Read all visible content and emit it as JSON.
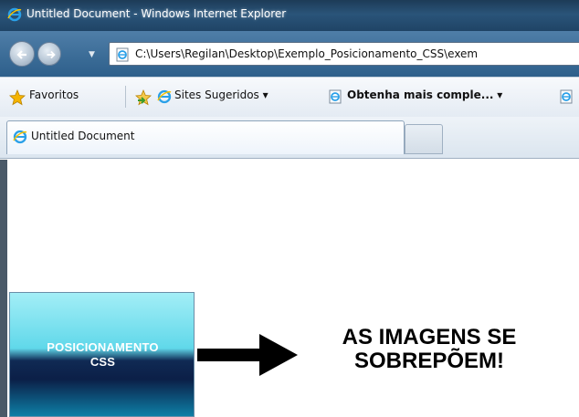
{
  "window": {
    "title": "Untitled Document - Windows Internet Explorer"
  },
  "address_bar": {
    "url": "C:\\Users\\Regilan\\Desktop\\Exemplo_Posicionamento_CSS\\exem"
  },
  "favorites_bar": {
    "favorites_label": "Favoritos",
    "sites_label": "Sites Sugeridos ▾",
    "more_label": "Obtenha mais comple...",
    "more_dropdown": "▾"
  },
  "tabs": [
    {
      "label": "Untitled Document"
    }
  ],
  "content": {
    "box_line1": "POSICIONAMENTO",
    "box_line2": "CSS",
    "message_line1": "AS IMAGENS SE",
    "message_line2": "SOBREPÕEM!"
  },
  "colors": {
    "title_bar": "#1f4466",
    "accent": "#3a6b96"
  },
  "icons": {
    "ie": "ie-logo-icon",
    "back": "back-arrow-icon",
    "forward": "forward-arrow-icon",
    "favorites": "star-icon"
  }
}
